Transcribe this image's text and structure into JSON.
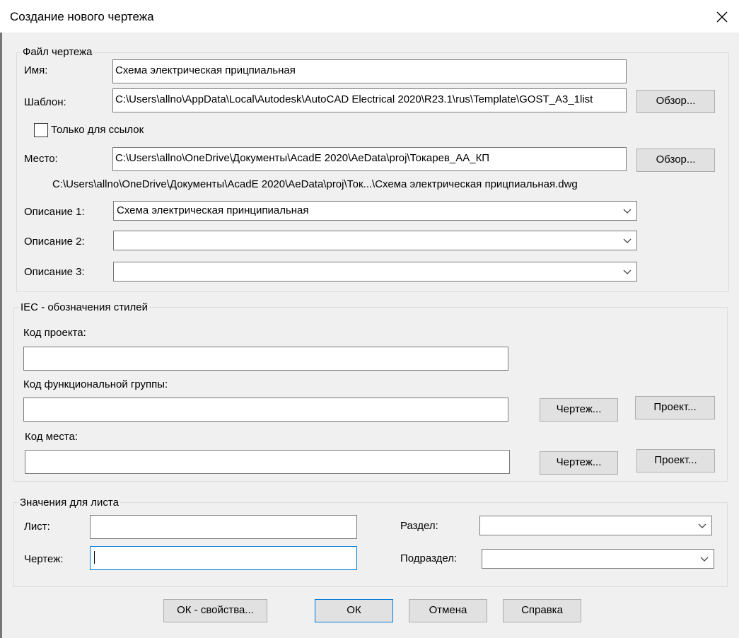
{
  "window": {
    "title": "Создание нового чертежа"
  },
  "file_group": {
    "legend": "Файл чертежа",
    "name_label": "Имя:",
    "name_value": "Схема электрическая прицпиальная",
    "template_label": "Шаблон:",
    "template_value": "C:\\Users\\allno\\AppData\\Local\\Autodesk\\AutoCAD Electrical 2020\\R23.1\\rus\\Template\\GOST_A3_1list",
    "browse_label": "Обзор...",
    "reference_only_label": "Только для ссылок",
    "location_label": "Место:",
    "location_value": "C:\\Users\\allno\\OneDrive\\Документы\\AcadE 2020\\AeData\\proj\\Токарев_АА_КП",
    "full_path": "C:\\Users\\allno\\OneDrive\\Документы\\AcadE 2020\\AeData\\proj\\Ток...\\Схема электрическая прицпиальная.dwg",
    "desc1_label": "Описание 1:",
    "desc1_value": "Схема электрическая принципиальная",
    "desc2_label": "Описание 2:",
    "desc2_value": "",
    "desc3_label": "Описание 3:",
    "desc3_value": ""
  },
  "iec_group": {
    "legend": "IEC - обозначения стилей",
    "project_code_label": "Код проекта:",
    "project_code_value": "",
    "function_code_label": "Код функциональной группы:",
    "function_code_value": "",
    "location_code_label": "Код места:",
    "location_code_value": "",
    "drawing_button": "Чертеж...",
    "project_button": "Проект..."
  },
  "sheet_group": {
    "legend": "Значения для листа",
    "sheet_label": "Лист:",
    "sheet_value": "",
    "drawing_label": "Чертеж:",
    "drawing_value": "",
    "section_label": "Раздел:",
    "section_value": "",
    "subsection_label": "Подраздел:",
    "subsection_value": ""
  },
  "footer": {
    "ok_props": "ОК - свойства...",
    "ok": "ОК",
    "cancel": "Отмена",
    "help": "Справка"
  },
  "icons": {
    "close": "close-icon",
    "dropdown": "chevron-down-icon"
  },
  "colors": {
    "focus_border": "#0078d7",
    "dialog_bg": "#f0f0f0"
  }
}
